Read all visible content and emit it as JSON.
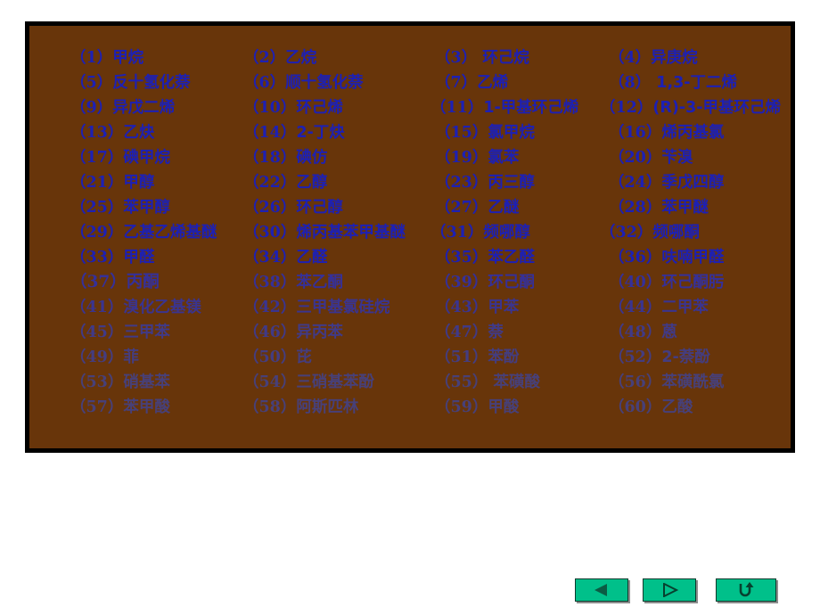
{
  "panel": {
    "background_color": "#68350a",
    "border_color": "#000000",
    "text_color": "#1d20b4",
    "highlight_color": "#0d0d0d"
  },
  "rows": [
    {
      "fade": 0,
      "wide": false,
      "cells": [
        {
          "index": "（1）",
          "name": "甲烷",
          "highlight": false
        },
        {
          "index": "（2）",
          "name": "乙烷",
          "highlight": false
        },
        {
          "index": "（3）",
          "name": " 环己烷",
          "highlight": false
        },
        {
          "index": "（4）",
          "name": "异庚烷",
          "highlight": false
        }
      ]
    },
    {
      "fade": 0,
      "wide": false,
      "cells": [
        {
          "index": "（5）",
          "name": "反十氢化萘",
          "highlight": false
        },
        {
          "index": "（6）",
          "name": "顺十氢化萘",
          "highlight": false
        },
        {
          "index": "（7）",
          "name": "乙烯",
          "highlight": false
        },
        {
          "index": "（8）",
          "name": " 1,3-丁二烯",
          "highlight": false
        }
      ]
    },
    {
      "fade": 0,
      "wide": true,
      "cells": [
        {
          "index": "（9）",
          "name": "异戊二烯",
          "highlight": false
        },
        {
          "index": "（10）",
          "name": "环己烯",
          "highlight": false
        },
        {
          "index": "（11）",
          "name": "1-甲基环己烯",
          "highlight": false
        },
        {
          "index": "（12）",
          "name": "(R)-3-甲基环己烯",
          "highlight": false
        }
      ]
    },
    {
      "fade": 0,
      "wide": false,
      "cells": [
        {
          "index": "（13）",
          "name": "乙炔",
          "highlight": false
        },
        {
          "index": "（14）",
          "name": "2-丁炔",
          "highlight": false
        },
        {
          "index": "（15）",
          "name": "氯甲烷",
          "highlight": false
        },
        {
          "index": "（16）",
          "name": "烯丙基氯",
          "highlight": false
        }
      ]
    },
    {
      "fade": 0,
      "wide": false,
      "cells": [
        {
          "index": "（17）",
          "name": "碘甲烷",
          "highlight": false
        },
        {
          "index": "（18）",
          "name": "碘仿",
          "highlight": false
        },
        {
          "index": "（19）",
          "name": "氯苯",
          "highlight": false
        },
        {
          "index": "（20）",
          "name": "苄溴",
          "highlight": false
        }
      ]
    },
    {
      "fade": 0,
      "wide": false,
      "cells": [
        {
          "index": "（21）",
          "name": "甲醇",
          "highlight": false
        },
        {
          "index": "（22）",
          "name": "乙醇",
          "highlight": false
        },
        {
          "index": "（23）",
          "name": "丙三醇",
          "highlight": false
        },
        {
          "index": "（24）",
          "name": "季戊四醇",
          "highlight": false
        }
      ]
    },
    {
      "fade": 0,
      "wide": false,
      "cells": [
        {
          "index": "（25）",
          "name": "苯甲醇",
          "highlight": false
        },
        {
          "index": "（26）",
          "name": "环己醇",
          "highlight": false
        },
        {
          "index": "（27）",
          "name": "乙醚",
          "highlight": false
        },
        {
          "index": "（28）",
          "name": "苯甲醚",
          "highlight": false
        }
      ]
    },
    {
      "fade": 0,
      "wide": true,
      "cells": [
        {
          "index": "（29）",
          "name": "乙基乙烯基醚",
          "highlight": false
        },
        {
          "index": "（30）",
          "name": "烯丙基苯甲基醚",
          "highlight": false
        },
        {
          "index": "（31）",
          "name": "频哪醇",
          "highlight": false
        },
        {
          "index": "（32）",
          "name": "频哪酮",
          "highlight": false
        }
      ]
    },
    {
      "fade": 0,
      "wide": false,
      "cells": [
        {
          "index": "（33）",
          "name": "甲醛",
          "highlight": false
        },
        {
          "index": "（34）",
          "name": "乙醛",
          "highlight": false
        },
        {
          "index": "（35）",
          "name": "苯乙醛",
          "highlight": false
        },
        {
          "index": "（36）",
          "name": "呋喃甲醛",
          "highlight": false
        }
      ]
    },
    {
      "fade": 1,
      "wide": false,
      "cells": [
        {
          "index": "（37）",
          "name": "丙酮",
          "highlight": true
        },
        {
          "index": "（38）",
          "name": "苯乙酮",
          "highlight": false
        },
        {
          "index": "（39）",
          "name": "环己酮",
          "highlight": false
        },
        {
          "index": "（40）",
          "name": "环己酮肟",
          "highlight": false
        }
      ]
    },
    {
      "fade": 2,
      "wide": false,
      "cells": [
        {
          "index": "（41）",
          "name": "溴化乙基镁",
          "highlight": false
        },
        {
          "index": "（42）",
          "name": "三甲基氯硅烷",
          "highlight": false
        },
        {
          "index": "（43）",
          "name": "甲苯",
          "highlight": false
        },
        {
          "index": "（44）",
          "name": "二甲苯",
          "highlight": false
        }
      ]
    },
    {
      "fade": 3,
      "wide": false,
      "cells": [
        {
          "index": "（45）",
          "name": "三甲苯",
          "highlight": false
        },
        {
          "index": "（46）",
          "name": "异丙苯",
          "highlight": false
        },
        {
          "index": "（47）",
          "name": "萘",
          "highlight": false
        },
        {
          "index": "（48）",
          "name": "蒽",
          "highlight": false
        }
      ]
    },
    {
      "fade": 4,
      "wide": false,
      "cells": [
        {
          "index": "（49）",
          "name": "菲",
          "highlight": false
        },
        {
          "index": "（50）",
          "name": "芘",
          "highlight": false
        },
        {
          "index": "（51）",
          "name": "苯酚",
          "highlight": false
        },
        {
          "index": "（52）",
          "name": "2-萘酚",
          "highlight": false
        }
      ]
    },
    {
      "fade": 5,
      "wide": false,
      "cells": [
        {
          "index": "（53）",
          "name": "硝基苯",
          "highlight": false
        },
        {
          "index": "（54）",
          "name": "三硝基苯酚",
          "highlight": false
        },
        {
          "index": "（55）",
          "name": " 苯磺酸",
          "highlight": false
        },
        {
          "index": "（56）",
          "name": "苯磺酰氯",
          "highlight": false
        }
      ]
    },
    {
      "fade": 5,
      "wide": false,
      "cells": [
        {
          "index": "（57）",
          "name": "苯甲酸",
          "highlight": false
        },
        {
          "index": "（58）",
          "name": "阿斯匹林",
          "highlight": false
        },
        {
          "index": "（59）",
          "name": "甲酸",
          "highlight": false
        },
        {
          "index": "（60）",
          "name": "乙酸",
          "highlight": false
        }
      ]
    }
  ],
  "nav": {
    "color": "#00c08a",
    "buttons": [
      {
        "name": "previous-slide-button",
        "icon": "triangle-left-icon",
        "label": ""
      },
      {
        "name": "next-slide-button",
        "icon": "triangle-right-icon",
        "label": ""
      },
      {
        "name": "return-home-button",
        "icon": "u-turn-arrow-icon",
        "label": ""
      }
    ]
  }
}
